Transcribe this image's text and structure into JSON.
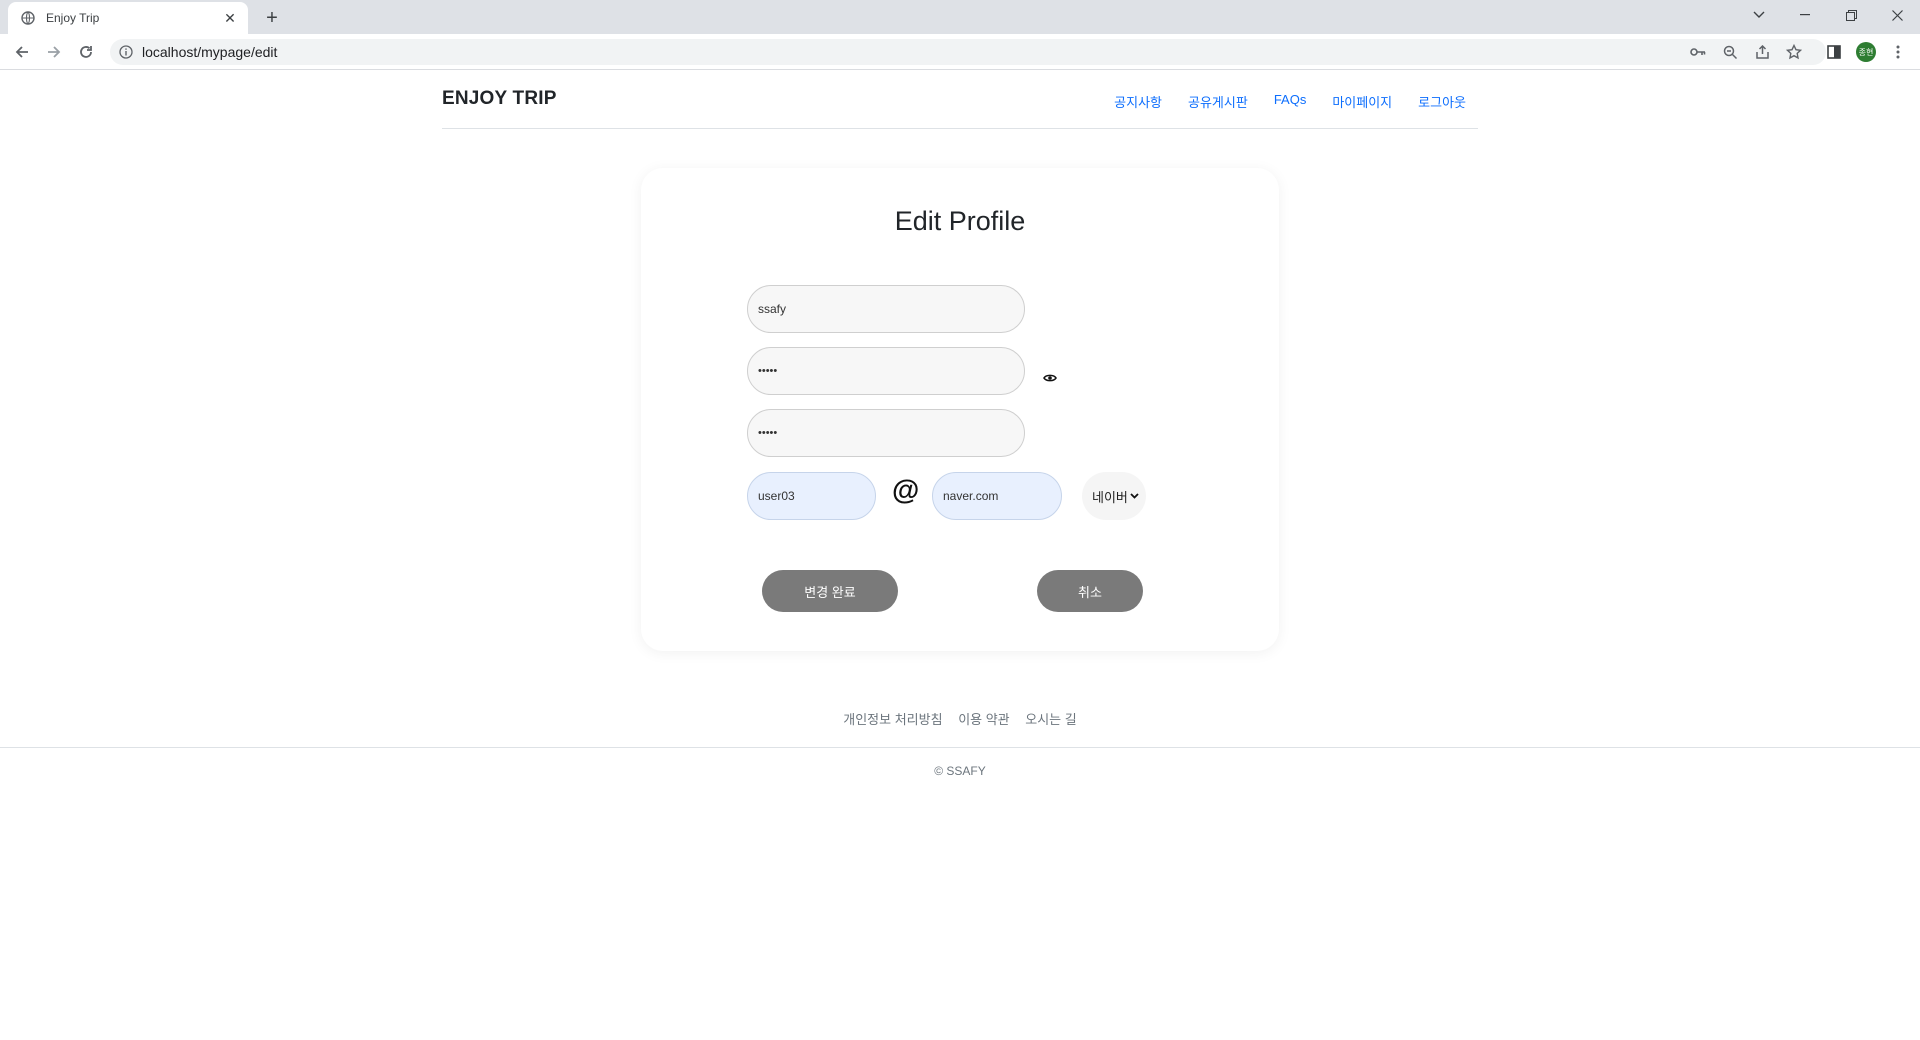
{
  "browser": {
    "tab_title": "Enjoy Trip",
    "tab_close": "✕",
    "new_tab": "+",
    "url": "localhost/mypage/edit",
    "profile_initial": "종현"
  },
  "header": {
    "brand": "ENJOY TRIP",
    "nav": [
      "공지사항",
      "공유게시판",
      "FAQs",
      "마이페이지",
      "로그아웃"
    ]
  },
  "form": {
    "title": "Edit Profile",
    "user_id": "ssafy",
    "password_mask": "•••••",
    "password_confirm_mask": "•••••",
    "email_id": "user03",
    "at_sign": "@",
    "email_domain": "naver.com",
    "domain_select": "네이버",
    "submit_label": "변경 완료",
    "cancel_label": "취소"
  },
  "footer": {
    "links": [
      "개인정보 처리방침",
      "이용 약관",
      "오시는 길"
    ],
    "copyright": "© SSAFY"
  },
  "colors": {
    "nav_link": "#0d6efd",
    "button": "#7a7a7a",
    "autofill": "#e8f0fe"
  }
}
